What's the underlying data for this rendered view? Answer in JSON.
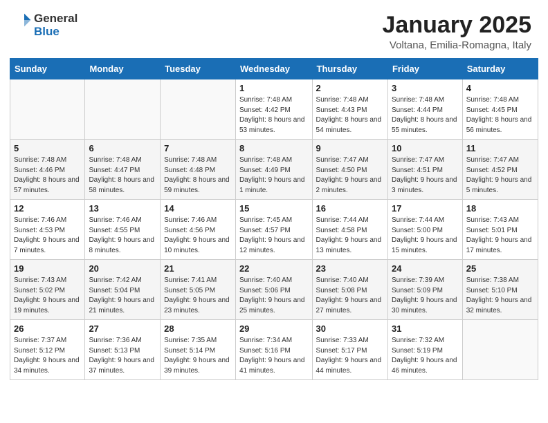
{
  "header": {
    "logo_general": "General",
    "logo_blue": "Blue",
    "month_title": "January 2025",
    "location": "Voltana, Emilia-Romagna, Italy"
  },
  "days_of_week": [
    "Sunday",
    "Monday",
    "Tuesday",
    "Wednesday",
    "Thursday",
    "Friday",
    "Saturday"
  ],
  "weeks": [
    [
      {
        "day": "",
        "info": ""
      },
      {
        "day": "",
        "info": ""
      },
      {
        "day": "",
        "info": ""
      },
      {
        "day": "1",
        "info": "Sunrise: 7:48 AM\nSunset: 4:42 PM\nDaylight: 8 hours and 53 minutes."
      },
      {
        "day": "2",
        "info": "Sunrise: 7:48 AM\nSunset: 4:43 PM\nDaylight: 8 hours and 54 minutes."
      },
      {
        "day": "3",
        "info": "Sunrise: 7:48 AM\nSunset: 4:44 PM\nDaylight: 8 hours and 55 minutes."
      },
      {
        "day": "4",
        "info": "Sunrise: 7:48 AM\nSunset: 4:45 PM\nDaylight: 8 hours and 56 minutes."
      }
    ],
    [
      {
        "day": "5",
        "info": "Sunrise: 7:48 AM\nSunset: 4:46 PM\nDaylight: 8 hours and 57 minutes."
      },
      {
        "day": "6",
        "info": "Sunrise: 7:48 AM\nSunset: 4:47 PM\nDaylight: 8 hours and 58 minutes."
      },
      {
        "day": "7",
        "info": "Sunrise: 7:48 AM\nSunset: 4:48 PM\nDaylight: 8 hours and 59 minutes."
      },
      {
        "day": "8",
        "info": "Sunrise: 7:48 AM\nSunset: 4:49 PM\nDaylight: 9 hours and 1 minute."
      },
      {
        "day": "9",
        "info": "Sunrise: 7:47 AM\nSunset: 4:50 PM\nDaylight: 9 hours and 2 minutes."
      },
      {
        "day": "10",
        "info": "Sunrise: 7:47 AM\nSunset: 4:51 PM\nDaylight: 9 hours and 3 minutes."
      },
      {
        "day": "11",
        "info": "Sunrise: 7:47 AM\nSunset: 4:52 PM\nDaylight: 9 hours and 5 minutes."
      }
    ],
    [
      {
        "day": "12",
        "info": "Sunrise: 7:46 AM\nSunset: 4:53 PM\nDaylight: 9 hours and 7 minutes."
      },
      {
        "day": "13",
        "info": "Sunrise: 7:46 AM\nSunset: 4:55 PM\nDaylight: 9 hours and 8 minutes."
      },
      {
        "day": "14",
        "info": "Sunrise: 7:46 AM\nSunset: 4:56 PM\nDaylight: 9 hours and 10 minutes."
      },
      {
        "day": "15",
        "info": "Sunrise: 7:45 AM\nSunset: 4:57 PM\nDaylight: 9 hours and 12 minutes."
      },
      {
        "day": "16",
        "info": "Sunrise: 7:44 AM\nSunset: 4:58 PM\nDaylight: 9 hours and 13 minutes."
      },
      {
        "day": "17",
        "info": "Sunrise: 7:44 AM\nSunset: 5:00 PM\nDaylight: 9 hours and 15 minutes."
      },
      {
        "day": "18",
        "info": "Sunrise: 7:43 AM\nSunset: 5:01 PM\nDaylight: 9 hours and 17 minutes."
      }
    ],
    [
      {
        "day": "19",
        "info": "Sunrise: 7:43 AM\nSunset: 5:02 PM\nDaylight: 9 hours and 19 minutes."
      },
      {
        "day": "20",
        "info": "Sunrise: 7:42 AM\nSunset: 5:04 PM\nDaylight: 9 hours and 21 minutes."
      },
      {
        "day": "21",
        "info": "Sunrise: 7:41 AM\nSunset: 5:05 PM\nDaylight: 9 hours and 23 minutes."
      },
      {
        "day": "22",
        "info": "Sunrise: 7:40 AM\nSunset: 5:06 PM\nDaylight: 9 hours and 25 minutes."
      },
      {
        "day": "23",
        "info": "Sunrise: 7:40 AM\nSunset: 5:08 PM\nDaylight: 9 hours and 27 minutes."
      },
      {
        "day": "24",
        "info": "Sunrise: 7:39 AM\nSunset: 5:09 PM\nDaylight: 9 hours and 30 minutes."
      },
      {
        "day": "25",
        "info": "Sunrise: 7:38 AM\nSunset: 5:10 PM\nDaylight: 9 hours and 32 minutes."
      }
    ],
    [
      {
        "day": "26",
        "info": "Sunrise: 7:37 AM\nSunset: 5:12 PM\nDaylight: 9 hours and 34 minutes."
      },
      {
        "day": "27",
        "info": "Sunrise: 7:36 AM\nSunset: 5:13 PM\nDaylight: 9 hours and 37 minutes."
      },
      {
        "day": "28",
        "info": "Sunrise: 7:35 AM\nSunset: 5:14 PM\nDaylight: 9 hours and 39 minutes."
      },
      {
        "day": "29",
        "info": "Sunrise: 7:34 AM\nSunset: 5:16 PM\nDaylight: 9 hours and 41 minutes."
      },
      {
        "day": "30",
        "info": "Sunrise: 7:33 AM\nSunset: 5:17 PM\nDaylight: 9 hours and 44 minutes."
      },
      {
        "day": "31",
        "info": "Sunrise: 7:32 AM\nSunset: 5:19 PM\nDaylight: 9 hours and 46 minutes."
      },
      {
        "day": "",
        "info": ""
      }
    ]
  ]
}
